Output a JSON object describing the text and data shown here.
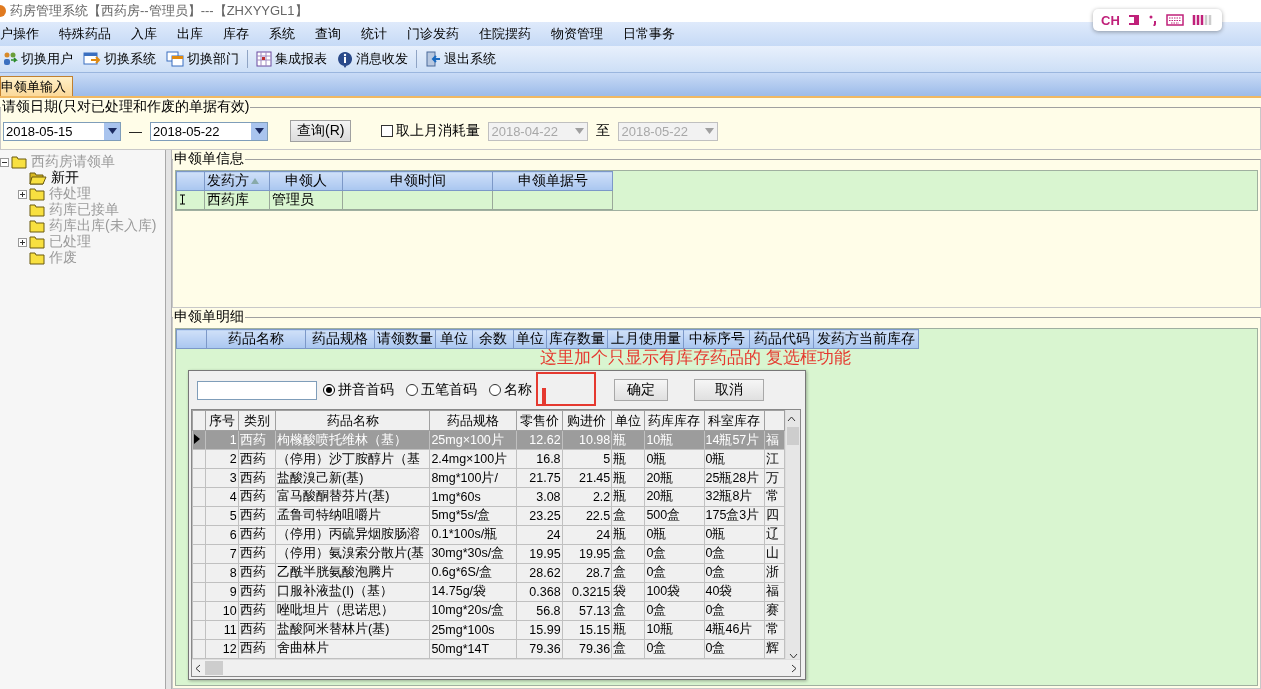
{
  "window": {
    "title": "药房管理系统【西药房--管理员】---【ZHXYYGL1】"
  },
  "ime": {
    "language": "CH"
  },
  "menu": [
    {
      "label": "户操作"
    },
    {
      "label": "特殊药品"
    },
    {
      "label": "入库"
    },
    {
      "label": "出库"
    },
    {
      "label": "库存"
    },
    {
      "label": "系统"
    },
    {
      "label": "查询"
    },
    {
      "label": "统计"
    },
    {
      "label": "门诊发药"
    },
    {
      "label": "住院摆药"
    },
    {
      "label": "物资管理"
    },
    {
      "label": "日常事务"
    }
  ],
  "toolbar": [
    {
      "label": "切换用户",
      "kind": "users",
      "separator_before": false
    },
    {
      "label": "切换系统",
      "kind": "switch",
      "separator_before": false
    },
    {
      "label": "切换部门",
      "kind": "window",
      "separator_before": false
    },
    {
      "label": "集成报表",
      "kind": "grid",
      "separator_before": true
    },
    {
      "label": "消息收发",
      "kind": "info",
      "separator_before": false
    },
    {
      "label": "退出系统",
      "kind": "exit",
      "separator_before": true
    }
  ],
  "tabs": [
    {
      "label": "申领单输入",
      "selected": true
    }
  ],
  "filter": {
    "legend": "请领日期(只对已处理和作废的单据有效)",
    "date_from": "2018-05-15",
    "dash": "—",
    "date_to": "2018-05-22",
    "query_button": "查询(R)",
    "last_month": {
      "label": "取上月消耗量",
      "checked": false
    },
    "range_from": {
      "value": "2018-04-22",
      "disabled": true
    },
    "range_sep": "至",
    "range_to": {
      "value": "2018-05-22",
      "disabled": true
    }
  },
  "tree": [
    {
      "label": "西药房请领单",
      "kind": "group",
      "expanded": true,
      "selected": false,
      "children": [
        {
          "label": "新开",
          "kind": "leaf",
          "selected": true
        },
        {
          "label": "待处理",
          "kind": "group",
          "expanded": false,
          "selected": false
        },
        {
          "label": "药库已接单",
          "kind": "leaf",
          "selected": false
        },
        {
          "label": "药库出库(未入库)",
          "kind": "leaf",
          "selected": false
        },
        {
          "label": "已处理",
          "kind": "group",
          "expanded": false,
          "selected": false
        },
        {
          "label": "作废",
          "kind": "leaf",
          "selected": false
        }
      ]
    }
  ],
  "info": {
    "legend": "申领单信息",
    "columns": [
      {
        "label": "发药方",
        "sorted": true
      },
      {
        "label": "申领人",
        "sorted": false
      },
      {
        "label": "申领时间",
        "sorted": false
      },
      {
        "label": "申领单据号",
        "sorted": false
      }
    ],
    "rows": [
      {
        "editing": true,
        "cells": [
          "西药库",
          "管理员"
        ]
      }
    ]
  },
  "detail": {
    "legend": "申领单明细",
    "columns": [
      "药品名称",
      "药品规格",
      "请领数量",
      "单位",
      "余数",
      "单位",
      "库存数量",
      "上月使用量",
      "中标序号",
      "药品代码",
      "发药方当前库存"
    ]
  },
  "annotation": {
    "text": "这里加个只显示有库存药品的 复选框功能"
  },
  "picker": {
    "search_modes": [
      {
        "label": "拼音首码",
        "selected": true
      },
      {
        "label": "五笔首码",
        "selected": false
      },
      {
        "label": "名称",
        "selected": false
      }
    ],
    "buttons": [
      "确定",
      "取消"
    ],
    "columns": [
      "序号",
      "类别",
      "药品名称",
      "药品规格",
      "零售价",
      "购进价",
      "单位",
      "药库库存",
      "科室库存"
    ],
    "rows": [
      {
        "selected": true,
        "cells": [
          "1",
          "西药",
          "枸橼酸喷托维林（基）",
          "25mg×100片",
          "12.62",
          "10.98",
          "瓶",
          "10瓶",
          "14瓶57片",
          "福"
        ]
      },
      {
        "selected": false,
        "cells": [
          "2",
          "西药",
          "（停用）沙丁胺醇片（基",
          "2.4mg×100片",
          "16.8",
          "5",
          "瓶",
          "0瓶",
          "0瓶",
          "江"
        ]
      },
      {
        "selected": false,
        "cells": [
          "3",
          "西药",
          "盐酸溴己新(基)",
          "8mg*100片/",
          "21.75",
          "21.45",
          "瓶",
          "20瓶",
          "25瓶28片",
          "万"
        ]
      },
      {
        "selected": false,
        "cells": [
          "4",
          "西药",
          "富马酸酮替芬片(基)",
          "1mg*60s",
          "3.08",
          "2.2",
          "瓶",
          "20瓶",
          "32瓶8片",
          "常"
        ]
      },
      {
        "selected": false,
        "cells": [
          "5",
          "西药",
          "孟鲁司特纳咀嚼片",
          "5mg*5s/盒",
          "23.25",
          "22.5",
          "盒",
          "500盒",
          "175盒3片",
          "四"
        ]
      },
      {
        "selected": false,
        "cells": [
          "6",
          "西药",
          "（停用）丙硫异烟胺肠溶",
          "0.1*100s/瓶",
          "24",
          "24",
          "瓶",
          "0瓶",
          "0瓶",
          "辽"
        ]
      },
      {
        "selected": false,
        "cells": [
          "7",
          "西药",
          "（停用）氨溴索分散片(基",
          "30mg*30s/盒",
          "19.95",
          "19.95",
          "盒",
          "0盒",
          "0盒",
          "山"
        ]
      },
      {
        "selected": false,
        "cells": [
          "8",
          "西药",
          "乙酰半胱氨酸泡腾片",
          "0.6g*6S/盒",
          "28.62",
          "28.7",
          "盒",
          "0盒",
          "0盒",
          "浙"
        ]
      },
      {
        "selected": false,
        "cells": [
          "9",
          "西药",
          "口服补液盐(I)（基）",
          "14.75g/袋",
          "0.368",
          "0.3215",
          "袋",
          "100袋",
          "40袋",
          "福"
        ]
      },
      {
        "selected": false,
        "cells": [
          "10",
          "西药",
          "唑吡坦片（思诺思）",
          "10mg*20s/盒",
          "56.8",
          "57.13",
          "盒",
          "0盒",
          "0盒",
          "赛"
        ]
      },
      {
        "selected": false,
        "cells": [
          "11",
          "西药",
          "盐酸阿米替林片(基)",
          "25mg*100s",
          "15.99",
          "15.15",
          "瓶",
          "10瓶",
          "4瓶46片",
          "常"
        ]
      },
      {
        "selected": false,
        "cells": [
          "12",
          "西药",
          "舍曲林片",
          "50mg*14T",
          "79.36",
          "79.36",
          "盒",
          "0盒",
          "0盒",
          "辉"
        ]
      }
    ]
  }
}
